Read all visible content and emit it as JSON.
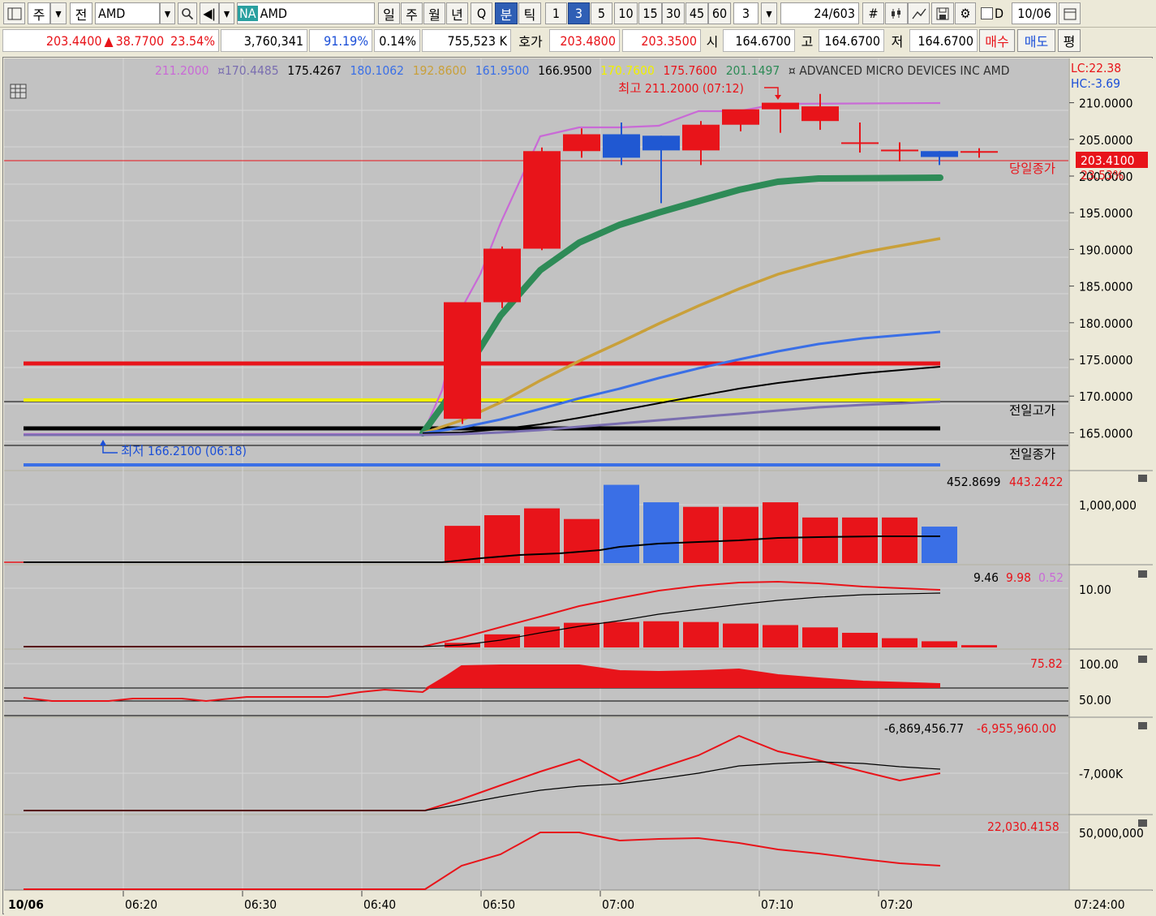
{
  "toolbar": {
    "type_1": "주",
    "type_2": "전",
    "symbol_code": "AMD",
    "exchange_badge": "NA",
    "symbol_name": "AMD",
    "period_tabs": [
      "일",
      "주",
      "월",
      "년",
      "Q",
      "분",
      "틱"
    ],
    "active_period": "분",
    "intervals": [
      "1",
      "3",
      "5",
      "10",
      "15",
      "30",
      "45",
      "60"
    ],
    "active_interval": "3",
    "interval_input": "3",
    "page_current": "24",
    "page_total": "/603",
    "date_checkbox_label": "D",
    "date_value": "10/06"
  },
  "quote": {
    "price": "203.4400",
    "change_arrow": "▲",
    "change": "38.7700",
    "change_pct": "23.54%",
    "volume": "3,760,341",
    "vol_ratio": "91.19%",
    "ratio2": "0.14%",
    "amount": "755,523 K",
    "hoga_label": "호가",
    "ask": "203.4800",
    "bid": "203.3500",
    "open_label": "시",
    "open": "164.6700",
    "high_label": "고",
    "high": "164.6700",
    "low_label": "저",
    "low": "164.6700",
    "buy_button": "매수",
    "sell_button": "매도",
    "eval_button": "평"
  },
  "chart": {
    "header_values": [
      {
        "text": "211.2000",
        "color": "#c96ad6"
      },
      {
        "text": "¤170.4485",
        "color": "#7a6eb0"
      },
      {
        "text": "175.4267",
        "color": "#000000"
      },
      {
        "text": "180.1062",
        "color": "#3a6fe6"
      },
      {
        "text": "192.8600",
        "color": "#c9a03a"
      },
      {
        "text": "161.9500",
        "color": "#3a6fe6"
      },
      {
        "text": "166.9500",
        "color": "#000000"
      },
      {
        "text": "170.7600",
        "color": "#f0f000"
      },
      {
        "text": "175.7600",
        "color": "#e8141a"
      },
      {
        "text": "201.1497",
        "color": "#2e8b57"
      },
      {
        "text": "¤ ADVANCED MICRO DEVICES INC  AMD",
        "color": "#303030"
      }
    ],
    "lc_label": "LC:22.38",
    "hc_label": "HC:-3.69",
    "max_label": "최고 211.2000 (07:12)",
    "min_label": "최저 166.2100 (06:18)",
    "today_close_label": "당일종가",
    "prev_high_label": "전일고가",
    "prev_close_label": "전일종가",
    "current_price_tag": "203.4100",
    "current_pct_tag": "23.53%",
    "price_axis": [
      "210.0000",
      "205.0000",
      "200.0000",
      "195.0000",
      "190.0000",
      "185.0000",
      "180.0000",
      "175.0000",
      "170.0000",
      "165.0000"
    ],
    "x_axis": [
      "10/06",
      "06:20",
      "06:30",
      "06:40",
      "06:50",
      "07:00",
      "07:10",
      "07:20"
    ],
    "x_axis_right": "07:24:00",
    "vol_values": {
      "v1": "452.8699",
      "v2": "443.2422"
    },
    "vol_axis": "1,000,000",
    "macd_values": {
      "v1": "9.46",
      "v2": "9.98",
      "v3": "0.52"
    },
    "macd_axis": "10.00",
    "rsi_value": "75.82",
    "rsi_axis": [
      "100.00",
      "50.00"
    ],
    "obv_values": {
      "v1": "-6,869,456.77",
      "v2": "-6,955,960.00"
    },
    "obv_axis": "-7,000K",
    "last_value": "22,030.4158",
    "last_axis": "50,000,000"
  },
  "chart_data": {
    "type": "candlestick",
    "timeframe": "3-minute",
    "times": [
      "06:45",
      "06:48",
      "06:51",
      "06:54",
      "06:57",
      "07:00",
      "07:03",
      "07:06",
      "07:09",
      "07:12",
      "07:15",
      "07:18",
      "07:21",
      "07:24"
    ],
    "open": [
      166.9,
      182.8,
      190.1,
      203.4,
      205.7,
      205.5,
      203.5,
      207.0,
      209.1,
      207.5,
      204.6,
      203.6,
      203.4,
      203.4
    ],
    "high": [
      182.8,
      190.4,
      203.9,
      206.5,
      207.3,
      205.5,
      207.5,
      208.0,
      210.0,
      211.2,
      207.3,
      204.6,
      203.4,
      203.8
    ],
    "low": [
      166.2,
      182.0,
      189.9,
      202.5,
      201.5,
      196.3,
      201.5,
      206.1,
      205.9,
      206.3,
      203.2,
      202.0,
      201.5,
      202.5
    ],
    "close": [
      182.8,
      190.1,
      203.4,
      205.7,
      202.5,
      203.5,
      207.0,
      209.1,
      210.0,
      209.5,
      204.6,
      203.6,
      202.6,
      203.4
    ],
    "volume": [
      490000,
      630000,
      720000,
      580000,
      1030000,
      800000,
      740000,
      740000,
      800000,
      600000,
      600000,
      600000,
      480000,
      0
    ],
    "price_range": [
      162.5,
      212.5
    ],
    "horizontal_levels": {
      "prev_high": 170.76,
      "prev_close": 166.95,
      "red_level": 175.76,
      "blue_level": 161.95
    }
  }
}
